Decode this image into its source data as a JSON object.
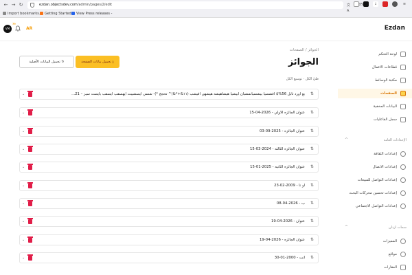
{
  "browser": {
    "url_host": "ezdan.objectsdev.com",
    "url_path": "/admin/pages/2/edit",
    "zoom": "110%",
    "bookmarks": [
      {
        "label": "Import bookmarks...",
        "color": "#888888"
      },
      {
        "label": "Getting Started",
        "color": "#f97316"
      },
      {
        "label": "View Press releases -",
        "color": "#2563eb"
      }
    ]
  },
  "header": {
    "brand": "Ezdan",
    "avatar_text": "VM",
    "notif_badge": "79",
    "language": "AR"
  },
  "sidebar": {
    "items": [
      {
        "label": "لوحة التحكم",
        "active": false
      },
      {
        "label": "قطاعات الاعمال",
        "active": false
      },
      {
        "label": "مكتبة الوسائط",
        "active": false
      },
      {
        "label": "الصفحات",
        "active": true
      },
      {
        "label": "البيانات المخفية",
        "active": false
      },
      {
        "label": "سجل الفاعليات",
        "active": false
      }
    ],
    "section_general": "الإعدادات العامة",
    "general_items": [
      {
        "label": "إعدادات الثقافة"
      },
      {
        "label": "إعدادات الاتصال"
      },
      {
        "label": "إعدادات التواصل للمبيعات"
      },
      {
        "label": "إعدادات تحسين محركات البحث"
      },
      {
        "label": "إعدادات التواصل الاجتماعي"
      }
    ],
    "section_ezdan": "سمات ازدان",
    "ezdan_items": [
      {
        "label": "المميزات"
      },
      {
        "label": "مواقع"
      },
      {
        "label": "العقارات"
      }
    ]
  },
  "main": {
    "breadcrumb_root": "الصفحات",
    "breadcrumb_sep": "/",
    "breadcrumb_current": "الجوائز",
    "title": "الجوائز",
    "save_label": "تحميل بيانات الصفحة",
    "load_label": "تحميل البيانات الأصلية",
    "toggle_label": "طيّ الكل · توسيع الكل",
    "rows": [
      "بع اورد تابل 56%$ افشسيا بيشسيانمشبان ابيشيا هيشاهيشه هيشهي افيشب (١١&+*&)^ تحجج *)- شسي ايسشيبت ايهسفب ايسفب بايست سيز – 21...",
      "عنوان الجائزه الاولي - 2026-04-15",
      "عنوان الجائزه - 2025-09-03",
      "عنوان الجائزه الثالثه - 2024-03-15",
      "عنوان الجائزه الثانيه - 2025-01-15",
      "او نا - 2009-02-23",
      "ب - 2026-04-08",
      "عنوان - 2026-04-19",
      "عنوان الجائزه - 2026-04-19",
      "انت - 2000-01-30"
    ]
  }
}
